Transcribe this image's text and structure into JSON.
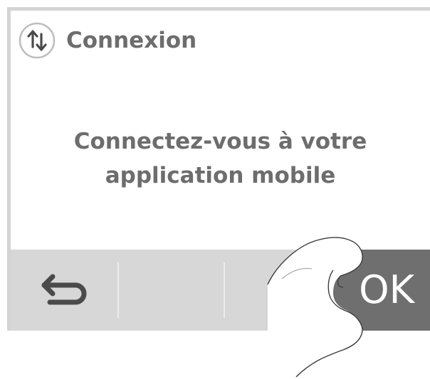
{
  "header": {
    "title": "Connexion",
    "icon": "up-down-arrows-icon"
  },
  "message": {
    "line1": "Connectez-vous à votre",
    "line2": "application mobile"
  },
  "bottom_bar": {
    "back_icon": "back-arrow-icon",
    "ok_label": "OK"
  },
  "colors": {
    "text_gray": "#6d6d6d",
    "bar_gray": "#d7d7d7",
    "ok_bg": "#6f6f6f",
    "frame": "#d4d4d4"
  }
}
